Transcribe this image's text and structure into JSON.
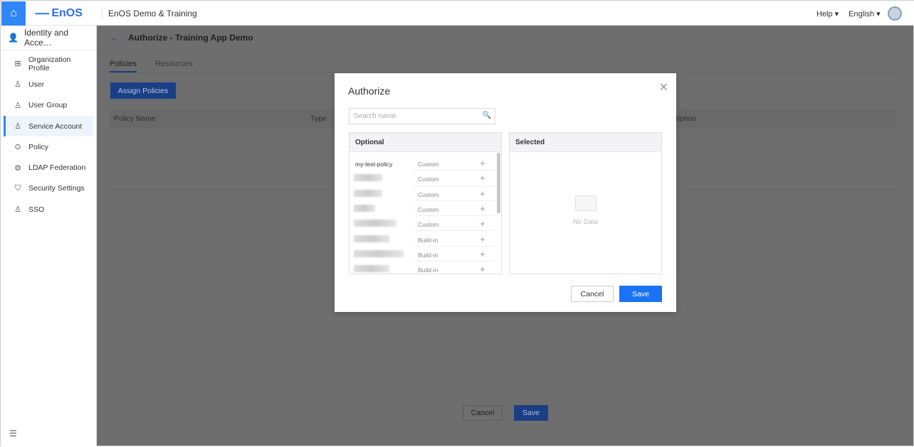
{
  "header": {
    "logo": "EnOS",
    "app_title": "EnOS Demo & Training",
    "help": "Help ▾",
    "language": "English ▾"
  },
  "sidebar": {
    "title": "Identity and Acce…",
    "items": [
      {
        "label": "Organization Profile",
        "icon": "org-icon"
      },
      {
        "label": "User",
        "icon": "user-icon"
      },
      {
        "label": "User Group",
        "icon": "user-group-icon"
      },
      {
        "label": "Service Account",
        "icon": "service-account-icon",
        "active": true
      },
      {
        "label": "Policy",
        "icon": "policy-icon"
      },
      {
        "label": "LDAP Federation",
        "icon": "ldap-icon"
      },
      {
        "label": "Security Settings",
        "icon": "shield-icon"
      },
      {
        "label": "SSO",
        "icon": "sso-icon"
      }
    ]
  },
  "page": {
    "title": "Authorize - Training App Demo",
    "tabs": [
      "Policies",
      "Resources"
    ],
    "assign_label": "Assign Policies",
    "columns": [
      "Policy Name",
      "Type",
      "cription"
    ],
    "cancel": "Cancel",
    "save": "Save"
  },
  "modal": {
    "title": "Authorize",
    "search_placeholder": "Search name",
    "optional_header": "Optional",
    "selected_header": "Selected",
    "no_data": "No Data",
    "rows": [
      {
        "name": "my-test-policy",
        "type": "Custom"
      },
      {
        "name": "",
        "type": "Custom"
      },
      {
        "name": "",
        "type": "Custom"
      },
      {
        "name": "",
        "type": "Custom"
      },
      {
        "name": "",
        "type": "Custom"
      },
      {
        "name": "",
        "type": "Build-in"
      },
      {
        "name": "",
        "type": "Build-in"
      },
      {
        "name": "",
        "type": "Build-in"
      }
    ],
    "cancel": "Cancel",
    "save": "Save"
  },
  "colors": {
    "accent": "#1a73f5"
  }
}
